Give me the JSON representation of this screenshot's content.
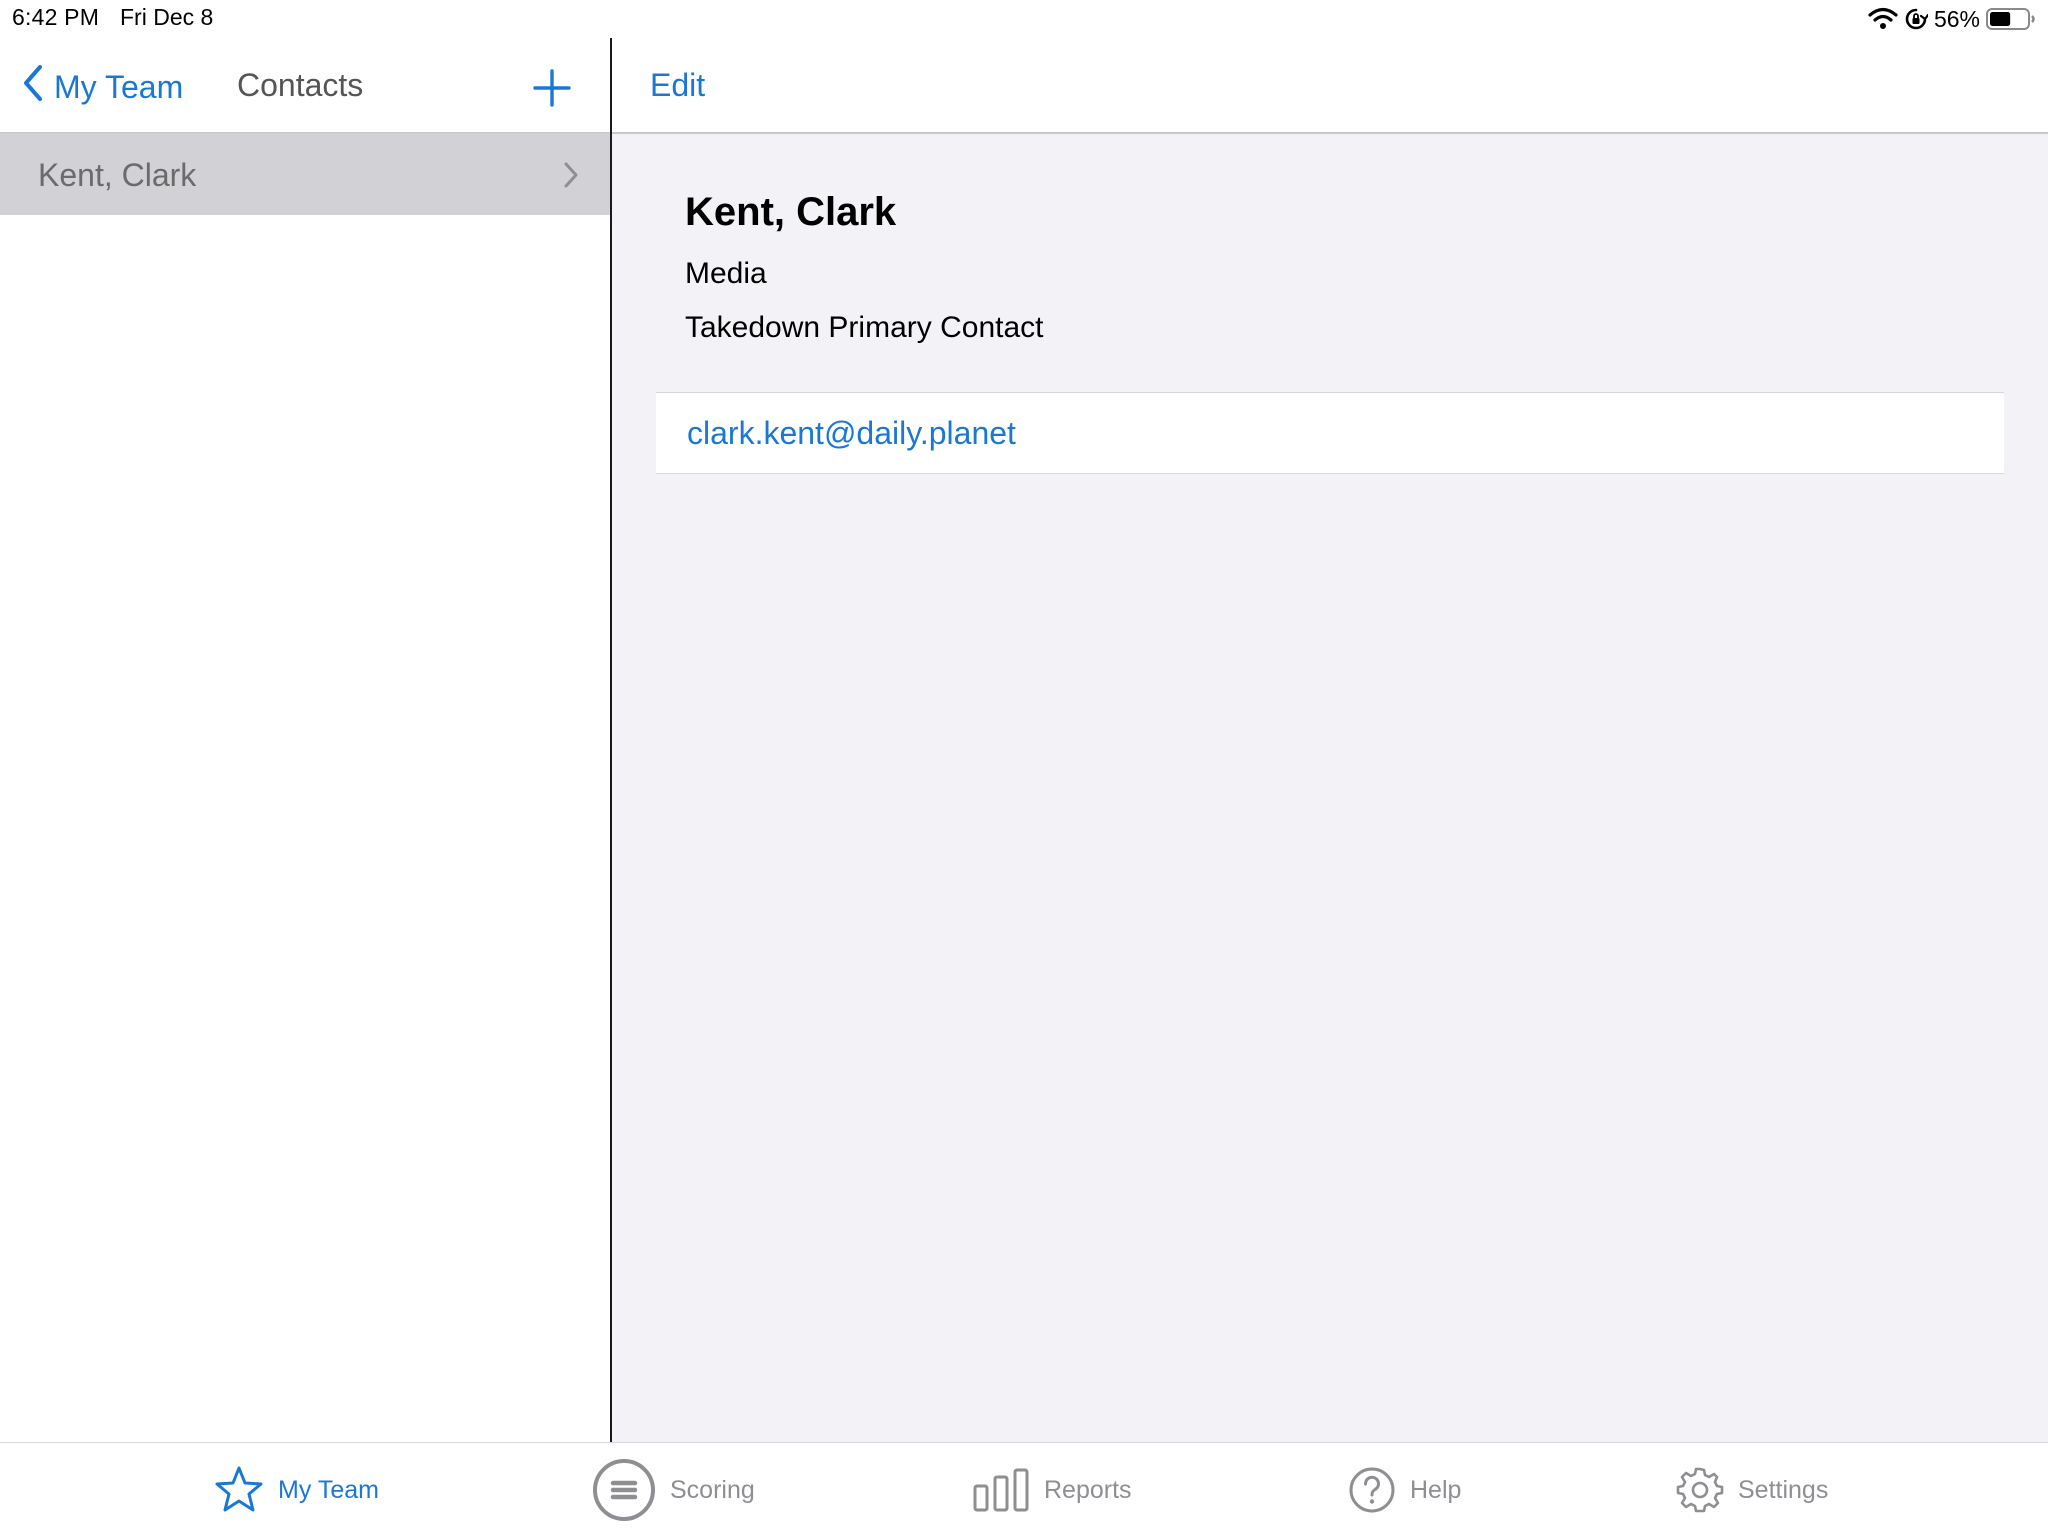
{
  "status_bar": {
    "time": "6:42 PM",
    "date": "Fri Dec 8",
    "battery": "56%",
    "battery_level": 0.56
  },
  "sidebar": {
    "back_label": "My Team",
    "title": "Contacts",
    "items": [
      {
        "label": "Kent, Clark",
        "selected": true
      }
    ]
  },
  "detail": {
    "edit_label": "Edit",
    "name": "Kent, Clark",
    "department": "Media",
    "role": "Takedown Primary Contact",
    "email": "clark.kent@daily.planet"
  },
  "tab_bar": {
    "tabs": [
      {
        "label": "My Team",
        "icon": "star-icon",
        "active": true
      },
      {
        "label": "Scoring",
        "icon": "scoring-icon",
        "active": false
      },
      {
        "label": "Reports",
        "icon": "bar-chart-icon",
        "active": false
      },
      {
        "label": "Help",
        "icon": "help-icon",
        "active": false
      },
      {
        "label": "Settings",
        "icon": "gear-icon",
        "active": false
      }
    ]
  },
  "colors": {
    "accent": "#1a78d4",
    "inactive": "#8e8e93",
    "selected_row": "#d1d1d6",
    "detail_background": "#f2f2f7"
  }
}
